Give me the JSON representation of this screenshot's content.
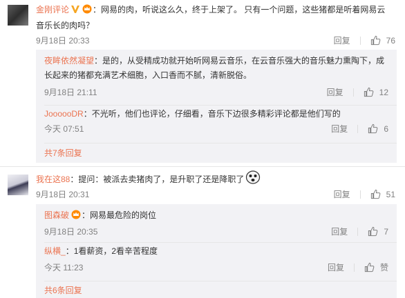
{
  "comments": [
    {
      "name": "金刚评论",
      "text": "：网易的肉，听说这么久，终于上架了。 只有一个问题，这些猪都是听着网易云音乐长的肉吗？",
      "time": "9月18日 20:33",
      "reply_label": "回复",
      "likes": "76",
      "replies": [
        {
          "name": "夜眸依然凝望",
          "text": "：是的，从受精成功就开始听网易云音乐，在云音乐强大的音乐魅力熏陶下，成长起来的猪都充满艺术细胞，入口香而不腻，清新脱俗。",
          "time": "9月18日 21:11",
          "reply_label": "回复",
          "likes": "12"
        },
        {
          "name": "JoooooDR",
          "text": "：不光听，他们也评论，仔细看，音乐下边很多精彩评论都是他们写的",
          "time": "今天 07:51",
          "reply_label": "回复",
          "likes": "6"
        }
      ],
      "more_label": "共7条回复"
    },
    {
      "name": "我在这88",
      "text": "：提问：被派去卖猪肉了，是升职了还是降职了",
      "time": "9月18日 20:31",
      "reply_label": "回复",
      "likes": "51",
      "replies": [
        {
          "name": "图森破",
          "text": "：网易最危险的岗位",
          "time": "9月18日 20:35",
          "reply_label": "回复",
          "likes": "7"
        },
        {
          "name": "纵横_",
          "text": "：1看薪资，2看辛苦程度",
          "time": "今天 11:23",
          "reply_label": "回复",
          "likes": "赞"
        }
      ],
      "more_label": "共6条回复"
    }
  ],
  "colors": {
    "name": "#eb7350",
    "text": "#333333",
    "meta": "#808080",
    "sub_bg": "#f2f2f5",
    "verified_gold": "#f5a623"
  },
  "icons": [
    "verified-v-icon",
    "vip-crown-icon",
    "thumbs-up-icon",
    "emoji-face-icon"
  ]
}
